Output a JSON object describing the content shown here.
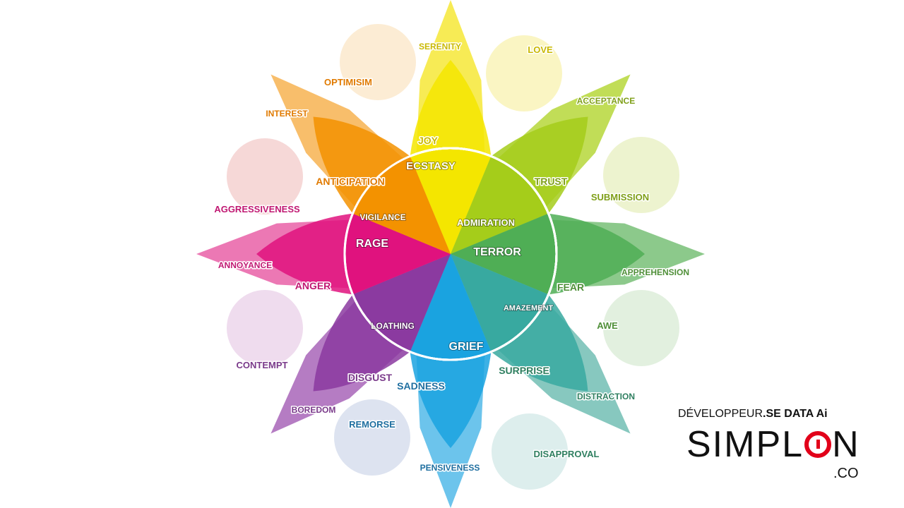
{
  "emotions": [
    {
      "color": "#f4e600",
      "petal": "#f7eb55",
      "circle": "#faf5c3",
      "label_color": "#c9b800",
      "outer": "SERENITY",
      "mid": "JOY",
      "inner": "ECSTASY",
      "opposite_circle": "LOVE"
    },
    {
      "color": "#a5cd1a",
      "petal": "#c1dd57",
      "circle": "#edf3cf",
      "label_color": "#7f9f18",
      "outer": "ACCEPTANCE",
      "mid": "TRUST",
      "inner": "ADMIRATION",
      "opposite_circle": "SUBMISSION"
    },
    {
      "color": "#4fae55",
      "petal": "#8cc98b",
      "circle": "#e2f0df",
      "label_color": "#4f8f38",
      "outer": "APPREHENSION",
      "mid": "FEAR",
      "inner": "TERROR",
      "opposite_circle": "AWE"
    },
    {
      "color": "#38a9a0",
      "petal": "#87c8bf",
      "circle": "#ddeeed",
      "label_color": "#2f7f60",
      "outer": "DISTRACTION",
      "mid": "SURPRISE",
      "inner": "AMAZEMENT",
      "opposite_circle": "DISAPPROVAL"
    },
    {
      "color": "#1aa3e0",
      "petal": "#6cc4ec",
      "circle": "#dde3f0",
      "label_color": "#1f6fa0",
      "outer": "PENSIVENESS",
      "mid": "SADNESS",
      "inner": "GRIEF",
      "opposite_circle": "REMORSE"
    },
    {
      "color": "#8b3aa0",
      "petal": "#b57cc3",
      "circle": "#efdcee",
      "label_color": "#7a3a8a",
      "outer": "BOREDOM",
      "mid": "DISGUST",
      "inner": "LOATHING",
      "opposite_circle": "CONTEMPT"
    },
    {
      "color": "#e0127e",
      "petal": "#ec78b4",
      "circle": "#f6d8d7",
      "label_color": "#c01872",
      "outer": "ANNOYANCE",
      "mid": "ANGER",
      "inner": "RAGE",
      "opposite_circle": "AGGRESSIVENESS"
    },
    {
      "color": "#f39200",
      "petal": "#f8be6b",
      "circle": "#fcecd4",
      "label_color": "#e07a00",
      "outer": "INTEREST",
      "mid": "ANTICIPATION",
      "inner": "VIGILANCE",
      "opposite_circle": "OPTIMISIM"
    }
  ],
  "branding": {
    "tagline_prefix": "DÉVELOPPEUR",
    "tagline_suffix": ".SE DATA Ai",
    "logo_before": "SIMPL",
    "logo_after": "N",
    "logo_suffix": ".CO",
    "accent_color": "#e2001a"
  }
}
